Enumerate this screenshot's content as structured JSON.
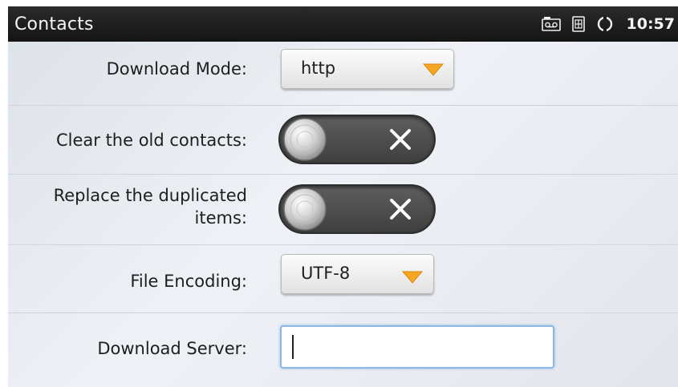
{
  "status_bar": {
    "app_title": "Contacts",
    "clock": "10:57",
    "icons": [
      "voicemail-icon",
      "sim-card-icon",
      "sync-icon"
    ]
  },
  "form": {
    "download_mode": {
      "label": "Download Mode:",
      "value": "http"
    },
    "clear_old_contacts": {
      "label": "Clear the old contacts:",
      "state": "off"
    },
    "replace_duplicated": {
      "label_line1": "Replace the duplicated",
      "label_line2": "items:",
      "state": "off"
    },
    "file_encoding": {
      "label": "File Encoding:",
      "value": "UTF-8"
    },
    "download_server": {
      "label": "Download Server:",
      "value": "",
      "placeholder": ""
    }
  },
  "colors": {
    "accent_arrow": "#f5a623",
    "focus_border": "#8fb7e4",
    "toggle_bg": "#4a4a4a"
  }
}
